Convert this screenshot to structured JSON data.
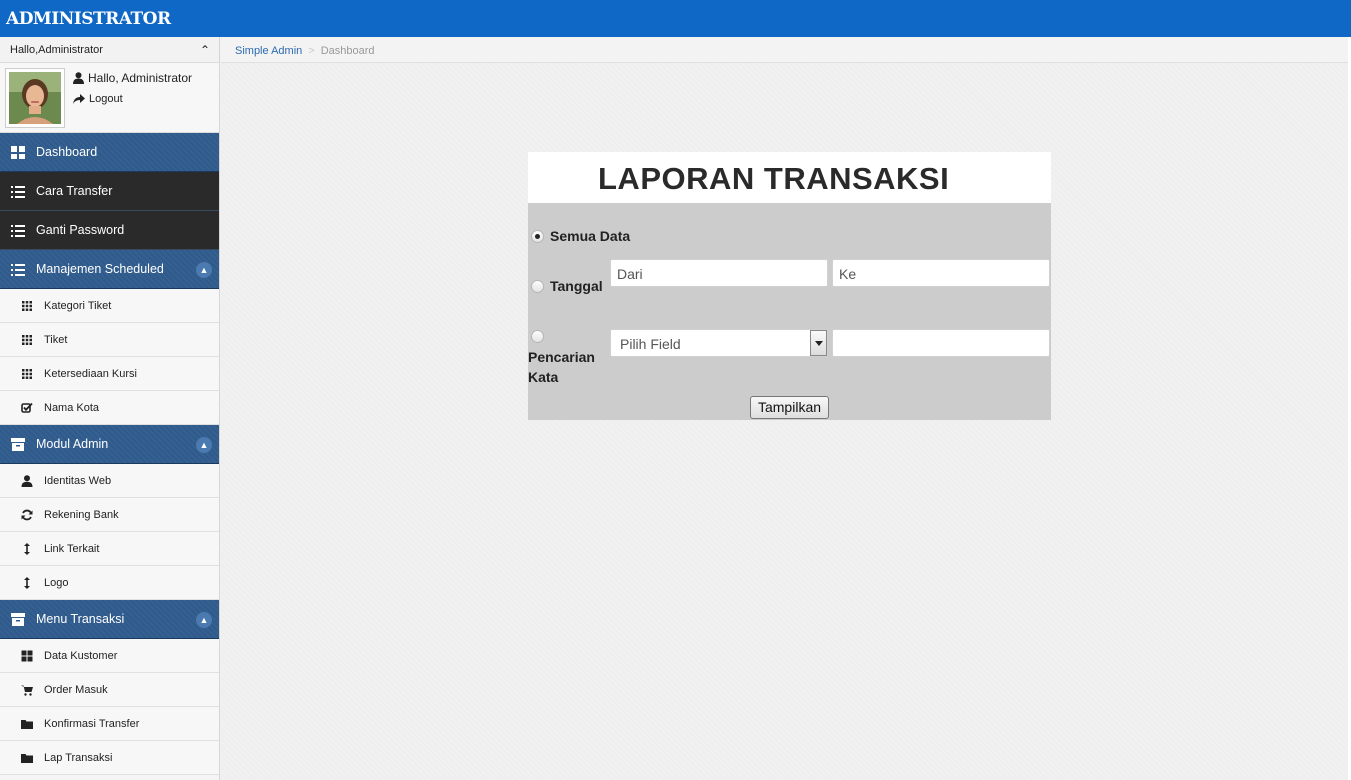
{
  "header": {
    "brand": "ADMINISTRATOR"
  },
  "sidebar": {
    "greeting": "Hallo,Administrator",
    "profile": {
      "name": "Hallo, Administrator",
      "logout": "Logout"
    },
    "menu": {
      "dashboard": "Dashboard",
      "cara_transfer": "Cara Transfer",
      "ganti_password": "Ganti Password",
      "manajemen_scheduled": {
        "label": "Manajemen Scheduled",
        "items": [
          "Kategori Tiket",
          "Tiket",
          "Ketersediaan Kursi",
          "Nama Kota"
        ]
      },
      "modul_admin": {
        "label": "Modul Admin",
        "items": [
          "Identitas Web",
          "Rekening Bank",
          "Link Terkait",
          "Logo"
        ]
      },
      "menu_transaksi": {
        "label": "Menu Transaksi",
        "items": [
          "Data Kustomer",
          "Order Masuk",
          "Konfirmasi Transfer",
          "Lap Transaksi"
        ]
      }
    }
  },
  "breadcrumb": {
    "home": "Simple Admin",
    "separator": ">",
    "current": "Dashboard"
  },
  "report": {
    "title": "LAPORAN TRANSAKSI",
    "options": {
      "semua_data": "Semua Data",
      "tanggal": "Tanggal",
      "pencarian_kata_line1": "Pencarian",
      "pencarian_kata_line2": "Kata"
    },
    "selected": "Semua Data",
    "date_from_placeholder": "Dari",
    "date_to_placeholder": "Ke",
    "field_select_value": "Pilih Field",
    "search_value": "",
    "submit": "Tampilkan"
  },
  "colors": {
    "topbar": "#0f68c5",
    "menu_blue": "#2e5a8c",
    "menu_dark": "#2a2a2a",
    "panel": "#cccccc"
  }
}
